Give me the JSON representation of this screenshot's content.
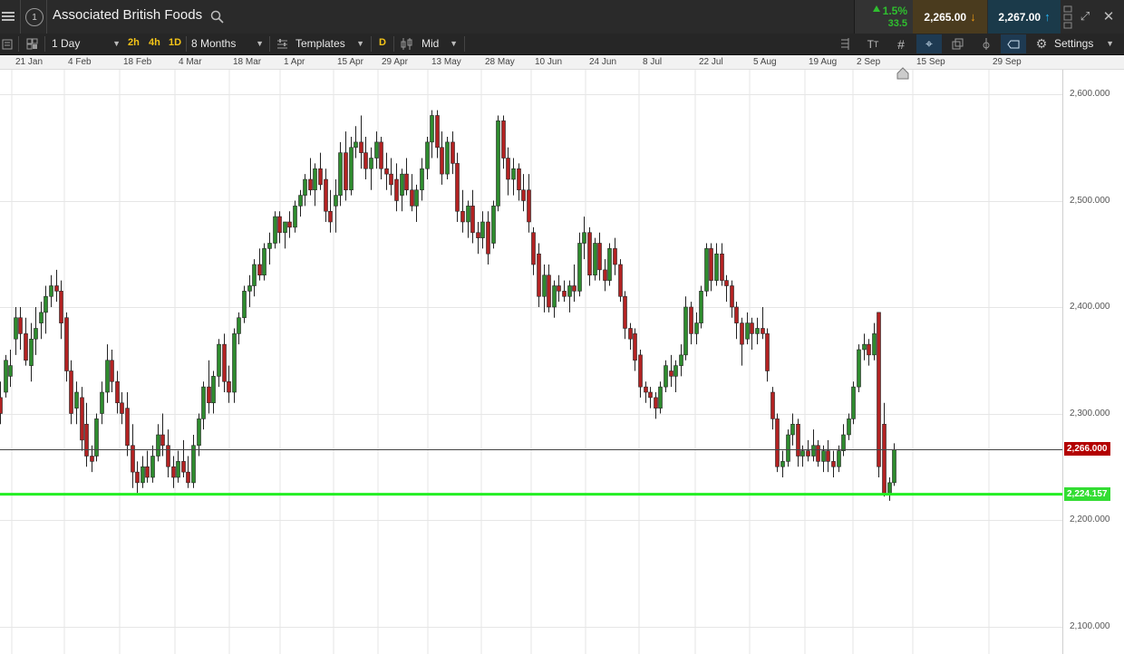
{
  "header": {
    "instrument_name": "Associated British Foods",
    "change_percent": "1.5%",
    "change_points": "33.5",
    "sell_price": "2,265.00",
    "buy_price": "2,267.00",
    "colors": {
      "sell_bg": "#4a3b1e",
      "buy_bg": "#1b3a4a",
      "up_green": "#2fbf2f"
    }
  },
  "toolbar": {
    "interval": "1 Day",
    "quick_intervals": [
      "2h",
      "4h",
      "1D"
    ],
    "period": "8 Months",
    "templates_label": "Templates",
    "d_label": "D",
    "price_type": "Mid",
    "settings_label": "Settings"
  },
  "x_axis": {
    "labels": [
      "21 Jan",
      "4 Feb",
      "18 Feb",
      "4 Mar",
      "18 Mar",
      "1 Apr",
      "15 Apr",
      "29 Apr",
      "13 May",
      "28 May",
      "10 Jun",
      "24 Jun",
      "8 Jul",
      "22 Jul",
      "5 Aug",
      "19 Aug",
      "2 Sep",
      "15 Sep",
      "29 Sep"
    ]
  },
  "y_axis": {
    "labels": [
      "2,600.000",
      "2,500.000",
      "2,400.000",
      "2,300.000",
      "2,200.000",
      "2,100.000"
    ]
  },
  "current_price_tag": "2,266.000",
  "support_line_tag": "2,224.157",
  "chart_data": {
    "type": "candlestick",
    "ylim": [
      2080,
      2630
    ],
    "current_price": 2266,
    "support_level": 2224.157,
    "candles": [
      {
        "o": 2315,
        "h": 2330,
        "l": 2290,
        "c": 2300
      },
      {
        "o": 2320,
        "h": 2355,
        "l": 2315,
        "c": 2350
      },
      {
        "o": 2335,
        "h": 2360,
        "l": 2325,
        "c": 2345
      },
      {
        "o": 2370,
        "h": 2400,
        "l": 2355,
        "c": 2390
      },
      {
        "o": 2390,
        "h": 2400,
        "l": 2360,
        "c": 2375
      },
      {
        "o": 2375,
        "h": 2390,
        "l": 2345,
        "c": 2350
      },
      {
        "o": 2345,
        "h": 2385,
        "l": 2330,
        "c": 2370
      },
      {
        "o": 2370,
        "h": 2400,
        "l": 2355,
        "c": 2380
      },
      {
        "o": 2385,
        "h": 2405,
        "l": 2370,
        "c": 2395
      },
      {
        "o": 2395,
        "h": 2420,
        "l": 2375,
        "c": 2410
      },
      {
        "o": 2410,
        "h": 2430,
        "l": 2400,
        "c": 2420
      },
      {
        "o": 2420,
        "h": 2435,
        "l": 2405,
        "c": 2415
      },
      {
        "o": 2415,
        "h": 2425,
        "l": 2370,
        "c": 2385
      },
      {
        "o": 2390,
        "h": 2395,
        "l": 2330,
        "c": 2340
      },
      {
        "o": 2340,
        "h": 2350,
        "l": 2290,
        "c": 2300
      },
      {
        "o": 2305,
        "h": 2330,
        "l": 2290,
        "c": 2320
      },
      {
        "o": 2315,
        "h": 2325,
        "l": 2265,
        "c": 2275
      },
      {
        "o": 2290,
        "h": 2310,
        "l": 2250,
        "c": 2260
      },
      {
        "o": 2260,
        "h": 2270,
        "l": 2245,
        "c": 2255
      },
      {
        "o": 2260,
        "h": 2300,
        "l": 2255,
        "c": 2295
      },
      {
        "o": 2300,
        "h": 2330,
        "l": 2290,
        "c": 2320
      },
      {
        "o": 2320,
        "h": 2365,
        "l": 2310,
        "c": 2350
      },
      {
        "o": 2350,
        "h": 2360,
        "l": 2320,
        "c": 2330
      },
      {
        "o": 2330,
        "h": 2340,
        "l": 2300,
        "c": 2310
      },
      {
        "o": 2310,
        "h": 2320,
        "l": 2290,
        "c": 2300
      },
      {
        "o": 2305,
        "h": 2320,
        "l": 2260,
        "c": 2270
      },
      {
        "o": 2270,
        "h": 2290,
        "l": 2230,
        "c": 2245
      },
      {
        "o": 2245,
        "h": 2255,
        "l": 2225,
        "c": 2235
      },
      {
        "o": 2235,
        "h": 2260,
        "l": 2230,
        "c": 2250
      },
      {
        "o": 2250,
        "h": 2265,
        "l": 2235,
        "c": 2240
      },
      {
        "o": 2240,
        "h": 2270,
        "l": 2235,
        "c": 2260
      },
      {
        "o": 2260,
        "h": 2290,
        "l": 2255,
        "c": 2280
      },
      {
        "o": 2280,
        "h": 2300,
        "l": 2260,
        "c": 2270
      },
      {
        "o": 2270,
        "h": 2285,
        "l": 2240,
        "c": 2250
      },
      {
        "o": 2250,
        "h": 2260,
        "l": 2230,
        "c": 2240
      },
      {
        "o": 2240,
        "h": 2265,
        "l": 2235,
        "c": 2255
      },
      {
        "o": 2255,
        "h": 2275,
        "l": 2240,
        "c": 2245
      },
      {
        "o": 2245,
        "h": 2260,
        "l": 2230,
        "c": 2235
      },
      {
        "o": 2235,
        "h": 2280,
        "l": 2230,
        "c": 2270
      },
      {
        "o": 2270,
        "h": 2300,
        "l": 2260,
        "c": 2295
      },
      {
        "o": 2295,
        "h": 2330,
        "l": 2285,
        "c": 2325
      },
      {
        "o": 2325,
        "h": 2350,
        "l": 2300,
        "c": 2310
      },
      {
        "o": 2310,
        "h": 2340,
        "l": 2300,
        "c": 2335
      },
      {
        "o": 2335,
        "h": 2370,
        "l": 2325,
        "c": 2365
      },
      {
        "o": 2365,
        "h": 2375,
        "l": 2320,
        "c": 2330
      },
      {
        "o": 2330,
        "h": 2345,
        "l": 2310,
        "c": 2320
      },
      {
        "o": 2320,
        "h": 2380,
        "l": 2310,
        "c": 2375
      },
      {
        "o": 2375,
        "h": 2395,
        "l": 2365,
        "c": 2390
      },
      {
        "o": 2390,
        "h": 2420,
        "l": 2385,
        "c": 2415
      },
      {
        "o": 2415,
        "h": 2430,
        "l": 2400,
        "c": 2420
      },
      {
        "o": 2420,
        "h": 2445,
        "l": 2410,
        "c": 2440
      },
      {
        "o": 2440,
        "h": 2455,
        "l": 2425,
        "c": 2430
      },
      {
        "o": 2430,
        "h": 2460,
        "l": 2425,
        "c": 2455
      },
      {
        "o": 2455,
        "h": 2470,
        "l": 2440,
        "c": 2460
      },
      {
        "o": 2460,
        "h": 2490,
        "l": 2455,
        "c": 2485
      },
      {
        "o": 2485,
        "h": 2490,
        "l": 2460,
        "c": 2470
      },
      {
        "o": 2470,
        "h": 2480,
        "l": 2455,
        "c": 2480
      },
      {
        "o": 2480,
        "h": 2490,
        "l": 2465,
        "c": 2475
      },
      {
        "o": 2475,
        "h": 2500,
        "l": 2470,
        "c": 2495
      },
      {
        "o": 2495,
        "h": 2510,
        "l": 2485,
        "c": 2505
      },
      {
        "o": 2505,
        "h": 2525,
        "l": 2495,
        "c": 2520
      },
      {
        "o": 2520,
        "h": 2540,
        "l": 2505,
        "c": 2510
      },
      {
        "o": 2510,
        "h": 2535,
        "l": 2495,
        "c": 2530
      },
      {
        "o": 2530,
        "h": 2545,
        "l": 2510,
        "c": 2515
      },
      {
        "o": 2520,
        "h": 2530,
        "l": 2480,
        "c": 2490
      },
      {
        "o": 2490,
        "h": 2510,
        "l": 2470,
        "c": 2480
      },
      {
        "o": 2495,
        "h": 2520,
        "l": 2470,
        "c": 2505
      },
      {
        "o": 2505,
        "h": 2555,
        "l": 2495,
        "c": 2545
      },
      {
        "o": 2545,
        "h": 2565,
        "l": 2500,
        "c": 2510
      },
      {
        "o": 2510,
        "h": 2560,
        "l": 2505,
        "c": 2550
      },
      {
        "o": 2550,
        "h": 2570,
        "l": 2540,
        "c": 2555
      },
      {
        "o": 2555,
        "h": 2580,
        "l": 2530,
        "c": 2545
      },
      {
        "o": 2545,
        "h": 2560,
        "l": 2520,
        "c": 2530
      },
      {
        "o": 2530,
        "h": 2550,
        "l": 2510,
        "c": 2540
      },
      {
        "o": 2540,
        "h": 2565,
        "l": 2530,
        "c": 2555
      },
      {
        "o": 2555,
        "h": 2560,
        "l": 2520,
        "c": 2530
      },
      {
        "o": 2530,
        "h": 2545,
        "l": 2510,
        "c": 2525
      },
      {
        "o": 2525,
        "h": 2540,
        "l": 2505,
        "c": 2515
      },
      {
        "o": 2520,
        "h": 2535,
        "l": 2490,
        "c": 2500
      },
      {
        "o": 2505,
        "h": 2530,
        "l": 2490,
        "c": 2525
      },
      {
        "o": 2525,
        "h": 2540,
        "l": 2505,
        "c": 2510
      },
      {
        "o": 2510,
        "h": 2525,
        "l": 2490,
        "c": 2495
      },
      {
        "o": 2495,
        "h": 2515,
        "l": 2480,
        "c": 2510
      },
      {
        "o": 2510,
        "h": 2540,
        "l": 2500,
        "c": 2530
      },
      {
        "o": 2530,
        "h": 2560,
        "l": 2520,
        "c": 2555
      },
      {
        "o": 2555,
        "h": 2585,
        "l": 2540,
        "c": 2580
      },
      {
        "o": 2580,
        "h": 2585,
        "l": 2540,
        "c": 2550
      },
      {
        "o": 2550,
        "h": 2565,
        "l": 2515,
        "c": 2525
      },
      {
        "o": 2525,
        "h": 2560,
        "l": 2520,
        "c": 2555
      },
      {
        "o": 2555,
        "h": 2565,
        "l": 2525,
        "c": 2535
      },
      {
        "o": 2535,
        "h": 2545,
        "l": 2480,
        "c": 2490
      },
      {
        "o": 2490,
        "h": 2510,
        "l": 2470,
        "c": 2480
      },
      {
        "o": 2480,
        "h": 2500,
        "l": 2465,
        "c": 2495
      },
      {
        "o": 2495,
        "h": 2510,
        "l": 2460,
        "c": 2470
      },
      {
        "o": 2470,
        "h": 2480,
        "l": 2450,
        "c": 2465
      },
      {
        "o": 2465,
        "h": 2490,
        "l": 2455,
        "c": 2480
      },
      {
        "o": 2480,
        "h": 2490,
        "l": 2440,
        "c": 2450
      },
      {
        "o": 2460,
        "h": 2500,
        "l": 2455,
        "c": 2495
      },
      {
        "o": 2495,
        "h": 2580,
        "l": 2490,
        "c": 2575
      },
      {
        "o": 2575,
        "h": 2580,
        "l": 2530,
        "c": 2540
      },
      {
        "o": 2540,
        "h": 2550,
        "l": 2505,
        "c": 2520
      },
      {
        "o": 2520,
        "h": 2540,
        "l": 2505,
        "c": 2530
      },
      {
        "o": 2530,
        "h": 2535,
        "l": 2500,
        "c": 2510
      },
      {
        "o": 2510,
        "h": 2525,
        "l": 2490,
        "c": 2500
      },
      {
        "o": 2510,
        "h": 2525,
        "l": 2470,
        "c": 2480
      },
      {
        "o": 2470,
        "h": 2475,
        "l": 2430,
        "c": 2440
      },
      {
        "o": 2450,
        "h": 2460,
        "l": 2400,
        "c": 2410
      },
      {
        "o": 2410,
        "h": 2440,
        "l": 2395,
        "c": 2430
      },
      {
        "o": 2430,
        "h": 2440,
        "l": 2395,
        "c": 2400
      },
      {
        "o": 2400,
        "h": 2425,
        "l": 2390,
        "c": 2420
      },
      {
        "o": 2420,
        "h": 2430,
        "l": 2405,
        "c": 2415
      },
      {
        "o": 2415,
        "h": 2425,
        "l": 2405,
        "c": 2410
      },
      {
        "o": 2410,
        "h": 2425,
        "l": 2395,
        "c": 2420
      },
      {
        "o": 2420,
        "h": 2440,
        "l": 2405,
        "c": 2415
      },
      {
        "o": 2415,
        "h": 2470,
        "l": 2410,
        "c": 2460
      },
      {
        "o": 2460,
        "h": 2485,
        "l": 2445,
        "c": 2470
      },
      {
        "o": 2470,
        "h": 2475,
        "l": 2420,
        "c": 2430
      },
      {
        "o": 2430,
        "h": 2465,
        "l": 2425,
        "c": 2460
      },
      {
        "o": 2460,
        "h": 2470,
        "l": 2425,
        "c": 2435
      },
      {
        "o": 2435,
        "h": 2445,
        "l": 2415,
        "c": 2425
      },
      {
        "o": 2425,
        "h": 2460,
        "l": 2420,
        "c": 2455
      },
      {
        "o": 2455,
        "h": 2465,
        "l": 2430,
        "c": 2440
      },
      {
        "o": 2440,
        "h": 2445,
        "l": 2405,
        "c": 2410
      },
      {
        "o": 2410,
        "h": 2415,
        "l": 2370,
        "c": 2380
      },
      {
        "o": 2380,
        "h": 2385,
        "l": 2360,
        "c": 2370
      },
      {
        "o": 2375,
        "h": 2380,
        "l": 2340,
        "c": 2350
      },
      {
        "o": 2355,
        "h": 2360,
        "l": 2315,
        "c": 2325
      },
      {
        "o": 2325,
        "h": 2330,
        "l": 2310,
        "c": 2320
      },
      {
        "o": 2320,
        "h": 2325,
        "l": 2305,
        "c": 2315
      },
      {
        "o": 2315,
        "h": 2320,
        "l": 2295,
        "c": 2305
      },
      {
        "o": 2305,
        "h": 2330,
        "l": 2300,
        "c": 2325
      },
      {
        "o": 2325,
        "h": 2350,
        "l": 2320,
        "c": 2345
      },
      {
        "o": 2340,
        "h": 2355,
        "l": 2325,
        "c": 2335
      },
      {
        "o": 2335,
        "h": 2350,
        "l": 2320,
        "c": 2345
      },
      {
        "o": 2345,
        "h": 2365,
        "l": 2335,
        "c": 2355
      },
      {
        "o": 2355,
        "h": 2410,
        "l": 2350,
        "c": 2400
      },
      {
        "o": 2400,
        "h": 2405,
        "l": 2365,
        "c": 2375
      },
      {
        "o": 2375,
        "h": 2395,
        "l": 2365,
        "c": 2385
      },
      {
        "o": 2385,
        "h": 2420,
        "l": 2380,
        "c": 2415
      },
      {
        "o": 2415,
        "h": 2460,
        "l": 2410,
        "c": 2455
      },
      {
        "o": 2455,
        "h": 2460,
        "l": 2415,
        "c": 2425
      },
      {
        "o": 2425,
        "h": 2460,
        "l": 2420,
        "c": 2450
      },
      {
        "o": 2450,
        "h": 2460,
        "l": 2420,
        "c": 2425
      },
      {
        "o": 2425,
        "h": 2430,
        "l": 2405,
        "c": 2420
      },
      {
        "o": 2420,
        "h": 2425,
        "l": 2390,
        "c": 2400
      },
      {
        "o": 2400,
        "h": 2405,
        "l": 2370,
        "c": 2385
      },
      {
        "o": 2385,
        "h": 2390,
        "l": 2345,
        "c": 2365
      },
      {
        "o": 2370,
        "h": 2395,
        "l": 2365,
        "c": 2385
      },
      {
        "o": 2385,
        "h": 2390,
        "l": 2360,
        "c": 2375
      },
      {
        "o": 2375,
        "h": 2390,
        "l": 2365,
        "c": 2380
      },
      {
        "o": 2380,
        "h": 2400,
        "l": 2370,
        "c": 2375
      },
      {
        "o": 2375,
        "h": 2380,
        "l": 2330,
        "c": 2340
      },
      {
        "o": 2320,
        "h": 2325,
        "l": 2285,
        "c": 2295
      },
      {
        "o": 2295,
        "h": 2300,
        "l": 2245,
        "c": 2250
      },
      {
        "o": 2250,
        "h": 2265,
        "l": 2240,
        "c": 2255
      },
      {
        "o": 2255,
        "h": 2285,
        "l": 2250,
        "c": 2280
      },
      {
        "o": 2280,
        "h": 2300,
        "l": 2270,
        "c": 2290
      },
      {
        "o": 2290,
        "h": 2295,
        "l": 2250,
        "c": 2260
      },
      {
        "o": 2260,
        "h": 2270,
        "l": 2250,
        "c": 2265
      },
      {
        "o": 2265,
        "h": 2275,
        "l": 2255,
        "c": 2260
      },
      {
        "o": 2260,
        "h": 2285,
        "l": 2255,
        "c": 2270
      },
      {
        "o": 2270,
        "h": 2275,
        "l": 2250,
        "c": 2255
      },
      {
        "o": 2255,
        "h": 2270,
        "l": 2245,
        "c": 2265
      },
      {
        "o": 2265,
        "h": 2275,
        "l": 2245,
        "c": 2255
      },
      {
        "o": 2255,
        "h": 2265,
        "l": 2240,
        "c": 2250
      },
      {
        "o": 2250,
        "h": 2270,
        "l": 2245,
        "c": 2265
      },
      {
        "o": 2265,
        "h": 2290,
        "l": 2260,
        "c": 2280
      },
      {
        "o": 2280,
        "h": 2300,
        "l": 2275,
        "c": 2295
      },
      {
        "o": 2295,
        "h": 2330,
        "l": 2290,
        "c": 2325
      },
      {
        "o": 2325,
        "h": 2365,
        "l": 2320,
        "c": 2360
      },
      {
        "o": 2360,
        "h": 2375,
        "l": 2350,
        "c": 2365
      },
      {
        "o": 2365,
        "h": 2370,
        "l": 2345,
        "c": 2355
      },
      {
        "o": 2355,
        "h": 2385,
        "l": 2350,
        "c": 2375
      },
      {
        "o": 2395,
        "h": 2395,
        "l": 2240,
        "c": 2250
      },
      {
        "o": 2290,
        "h": 2310,
        "l": 2222,
        "c": 2225
      },
      {
        "o": 2225,
        "h": 2240,
        "l": 2218,
        "c": 2235
      },
      {
        "o": 2235,
        "h": 2272,
        "l": 2232,
        "c": 2266
      }
    ]
  }
}
